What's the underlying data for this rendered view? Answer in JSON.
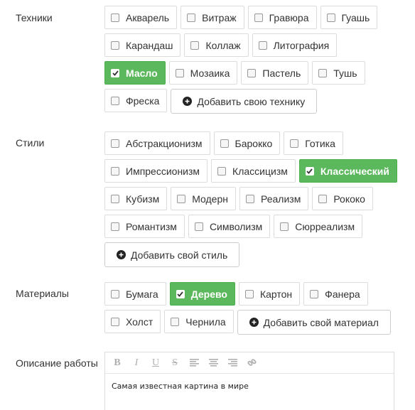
{
  "techniques": {
    "label": "Техники",
    "rows": [
      [
        {
          "label": "Акварель",
          "checked": false
        },
        {
          "label": "Витраж",
          "checked": false
        },
        {
          "label": "Гравюра",
          "checked": false
        },
        {
          "label": "Гуашь",
          "checked": false
        }
      ],
      [
        {
          "label": "Карандаш",
          "checked": false
        },
        {
          "label": "Коллаж",
          "checked": false
        },
        {
          "label": "Литография",
          "checked": false
        }
      ],
      [
        {
          "label": "Масло",
          "checked": true
        },
        {
          "label": "Мозаика",
          "checked": false
        },
        {
          "label": "Пастель",
          "checked": false
        },
        {
          "label": "Тушь",
          "checked": false
        }
      ],
      [
        {
          "label": "Фреска",
          "checked": false
        }
      ]
    ],
    "add_label": "Добавить свою технику"
  },
  "styles": {
    "label": "Стили",
    "rows": [
      [
        {
          "label": "Абстракционизм",
          "checked": false
        },
        {
          "label": "Барокко",
          "checked": false
        },
        {
          "label": "Готика",
          "checked": false
        }
      ],
      [
        {
          "label": "Импрессионизм",
          "checked": false
        },
        {
          "label": "Классицизм",
          "checked": false
        },
        {
          "label": "Классический",
          "checked": true
        }
      ],
      [
        {
          "label": "Кубизм",
          "checked": false
        },
        {
          "label": "Модерн",
          "checked": false
        },
        {
          "label": "Реализм",
          "checked": false
        },
        {
          "label": "Рококо",
          "checked": false
        }
      ],
      [
        {
          "label": "Романтизм",
          "checked": false
        },
        {
          "label": "Символизм",
          "checked": false
        },
        {
          "label": "Сюрреализм",
          "checked": false
        }
      ]
    ],
    "add_label": "Добавить свой стиль"
  },
  "materials": {
    "label": "Материалы",
    "rows": [
      [
        {
          "label": "Бумага",
          "checked": false
        },
        {
          "label": "Дерево",
          "checked": true
        },
        {
          "label": "Картон",
          "checked": false
        },
        {
          "label": "Фанера",
          "checked": false
        }
      ],
      [
        {
          "label": "Холст",
          "checked": false
        },
        {
          "label": "Чернила",
          "checked": false
        }
      ]
    ],
    "add_label": "Добавить свой материал"
  },
  "description": {
    "label": "Описание работы",
    "toolbar": [
      {
        "icon": "bold-icon",
        "glyph": "B"
      },
      {
        "icon": "italic-icon",
        "glyph": "I"
      },
      {
        "icon": "underline-icon",
        "glyph": "U"
      },
      {
        "icon": "strikethrough-icon",
        "glyph": "S"
      },
      {
        "icon": "align-left-icon",
        "glyph": ""
      },
      {
        "icon": "align-center-icon",
        "glyph": ""
      },
      {
        "icon": "align-right-icon",
        "glyph": ""
      },
      {
        "icon": "link-icon",
        "glyph": ""
      }
    ],
    "text": "Самая известная картина в мире"
  },
  "colors": {
    "checked_bg": "#5cb85c",
    "border": "#dcdcdc",
    "text": "#333333"
  }
}
